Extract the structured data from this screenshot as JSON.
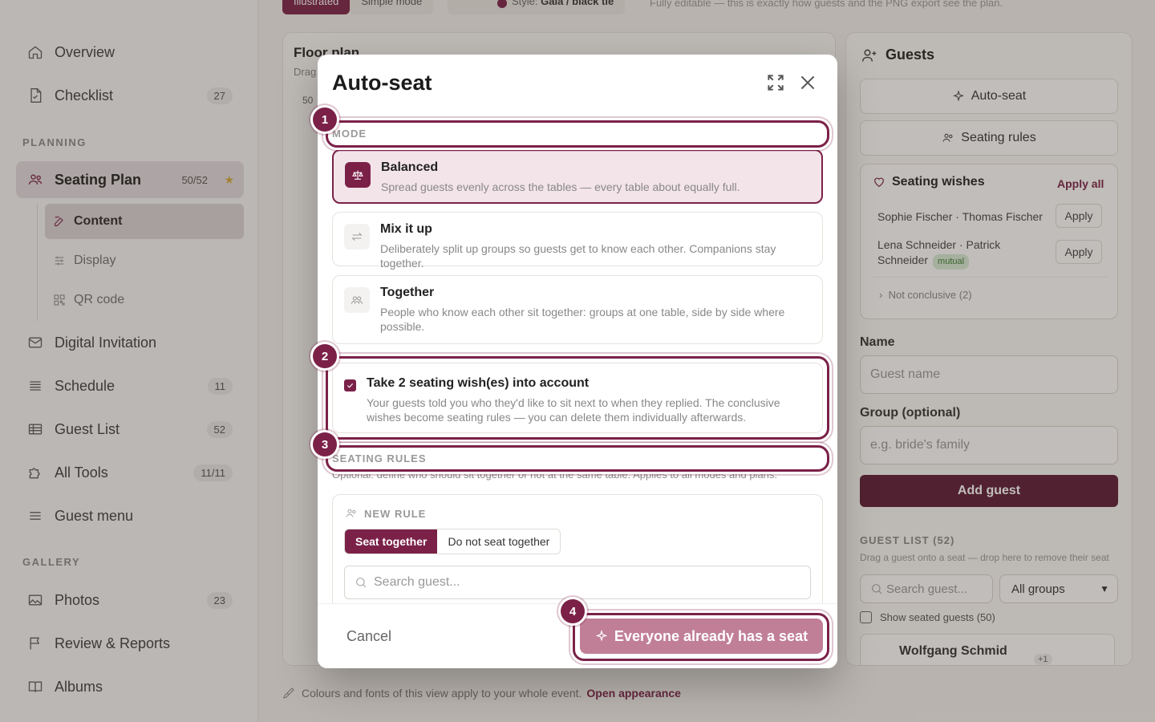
{
  "sidebar": {
    "items": [
      {
        "label": "Overview",
        "icon": "home-icon"
      },
      {
        "label": "Checklist",
        "icon": "document-icon",
        "badge": "27"
      }
    ],
    "planning_label": "PLANNING",
    "seating": {
      "label": "Seating Plan",
      "badge": "50/52",
      "icon": "people-icon"
    },
    "sub": [
      {
        "label": "Content",
        "icon": "edit-icon"
      },
      {
        "label": "Display",
        "icon": "sliders-icon"
      },
      {
        "label": "QR code",
        "icon": "qr-icon"
      }
    ],
    "more": [
      {
        "label": "Digital Invitation",
        "icon": "mail-icon"
      },
      {
        "label": "Schedule",
        "icon": "list-icon",
        "badge": "11"
      },
      {
        "label": "Guest List",
        "icon": "table-icon",
        "badge": "52"
      },
      {
        "label": "All Tools",
        "icon": "puzzle-icon",
        "badge": "11/11"
      },
      {
        "label": "Guest menu",
        "icon": "menu-icon"
      }
    ],
    "gallery_label": "GALLERY",
    "gallery": [
      {
        "label": "Photos",
        "icon": "image-icon",
        "badge": "23"
      },
      {
        "label": "Review & Reports",
        "icon": "flag-icon"
      },
      {
        "label": "Albums",
        "icon": "book-icon"
      }
    ]
  },
  "toolbar": {
    "tab_illustrated": "Illustrated",
    "tab_simple": "Simple mode",
    "style_prefix": "Style:",
    "style_value": "Gala / black tie",
    "hint": "Fully editable — this is exactly how guests and the PNG export see the plan."
  },
  "floor": {
    "title": "Floor plan",
    "sub": "Drag",
    "num": "50"
  },
  "guests_panel": {
    "title": "Guests",
    "auto_seat": "Auto-seat",
    "seating_rules": "Seating rules",
    "wishes_title": "Seating wishes",
    "apply_all": "Apply all",
    "wish1": "Sophie Fischer · Thomas Fischer",
    "wish2_line1": "Lena Schneider · Patrick",
    "wish2_line2": "Schneider",
    "mutual": "mutual",
    "apply": "Apply",
    "not_conclusive": "Not conclusive (2)",
    "name_label": "Name",
    "name_placeholder": "Guest name",
    "group_label": "Group (optional)",
    "group_placeholder": "e.g. bride's family",
    "add_guest": "Add guest",
    "list_label": "GUEST LIST (52)",
    "list_hint": "Drag a guest onto a seat — drop here to remove their seat",
    "search_placeholder": "Search guest...",
    "group_select": "All groups",
    "show_seated": "Show seated guests (50)",
    "first_guest": "Wolfgang Schmid",
    "first_guest_plus": "+1"
  },
  "footer": {
    "note": "Colours and fonts of this view apply to your whole event.",
    "link": "Open appearance"
  },
  "modal": {
    "title": "Auto-seat",
    "mode_label": "MODE",
    "modes": [
      {
        "title": "Balanced",
        "desc": "Spread guests evenly across the tables — every table about equally full."
      },
      {
        "title": "Mix it up",
        "desc": "Deliberately split up groups so guests get to know each other. Companions stay together."
      },
      {
        "title": "Together",
        "desc": "People who know each other sit together: groups at one table, side by side where possible."
      }
    ],
    "wish_title": "Take 2 seating wish(es) into account",
    "wish_desc": "Your guests told you who they'd like to sit next to when they replied. The conclusive wishes become seating rules — you can delete them individually afterwards.",
    "rules_label": "SEATING RULES",
    "rules_desc": "Optional: define who should sit together or not at the same table. Applies to all modes and plans.",
    "new_rule": "NEW RULE",
    "seat_together": "Seat together",
    "not_together": "Do not seat together",
    "search_placeholder": "Search guest...",
    "cancel": "Cancel",
    "primary": "Everyone already has a seat"
  },
  "markers": [
    "1",
    "2",
    "3",
    "4"
  ],
  "colors": {
    "accent": "#7b2148",
    "primary_disabled": "#c17f97"
  }
}
